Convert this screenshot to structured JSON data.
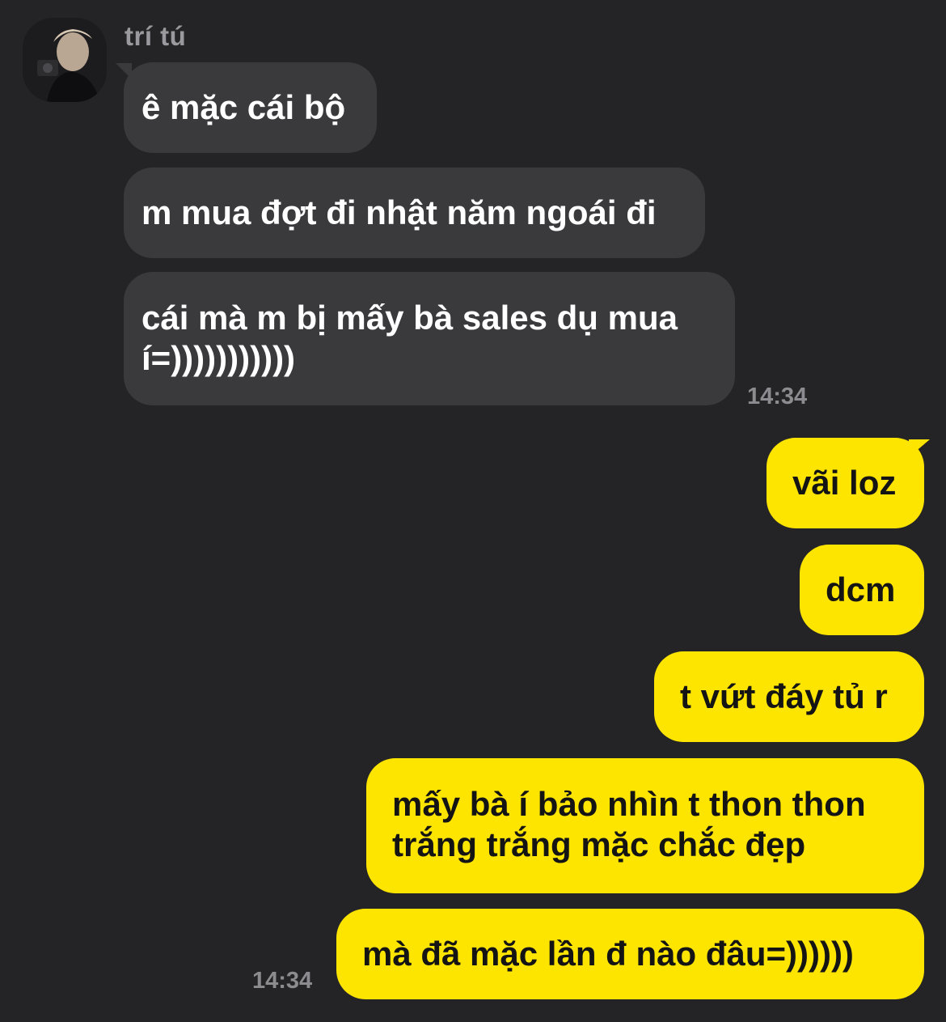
{
  "sender": {
    "name": "trí tú",
    "avatar_icon": "profile-photo"
  },
  "incoming": [
    {
      "text": "ê mặc cái bộ"
    },
    {
      "text": "m mua đợt đi nhật năm ngoái đi"
    },
    {
      "text": "cái mà m bị mấy bà sales dụ mua\ní=)))))))))))"
    }
  ],
  "incoming_time": "14:34",
  "outgoing": [
    {
      "text": "vãi loz"
    },
    {
      "text": "dcm"
    },
    {
      "text": "t vứt đáy tủ r"
    },
    {
      "text": "mấy bà í bảo nhìn t thon thon\ntrắng trắng mặc chắc đẹp"
    },
    {
      "text": "mà đã mặc lần đ nào đâu=))))))"
    }
  ],
  "outgoing_time": "14:34",
  "colors": {
    "background": "#242426",
    "incoming_bubble": "#3a3a3d",
    "outgoing_bubble": "#fee500"
  }
}
